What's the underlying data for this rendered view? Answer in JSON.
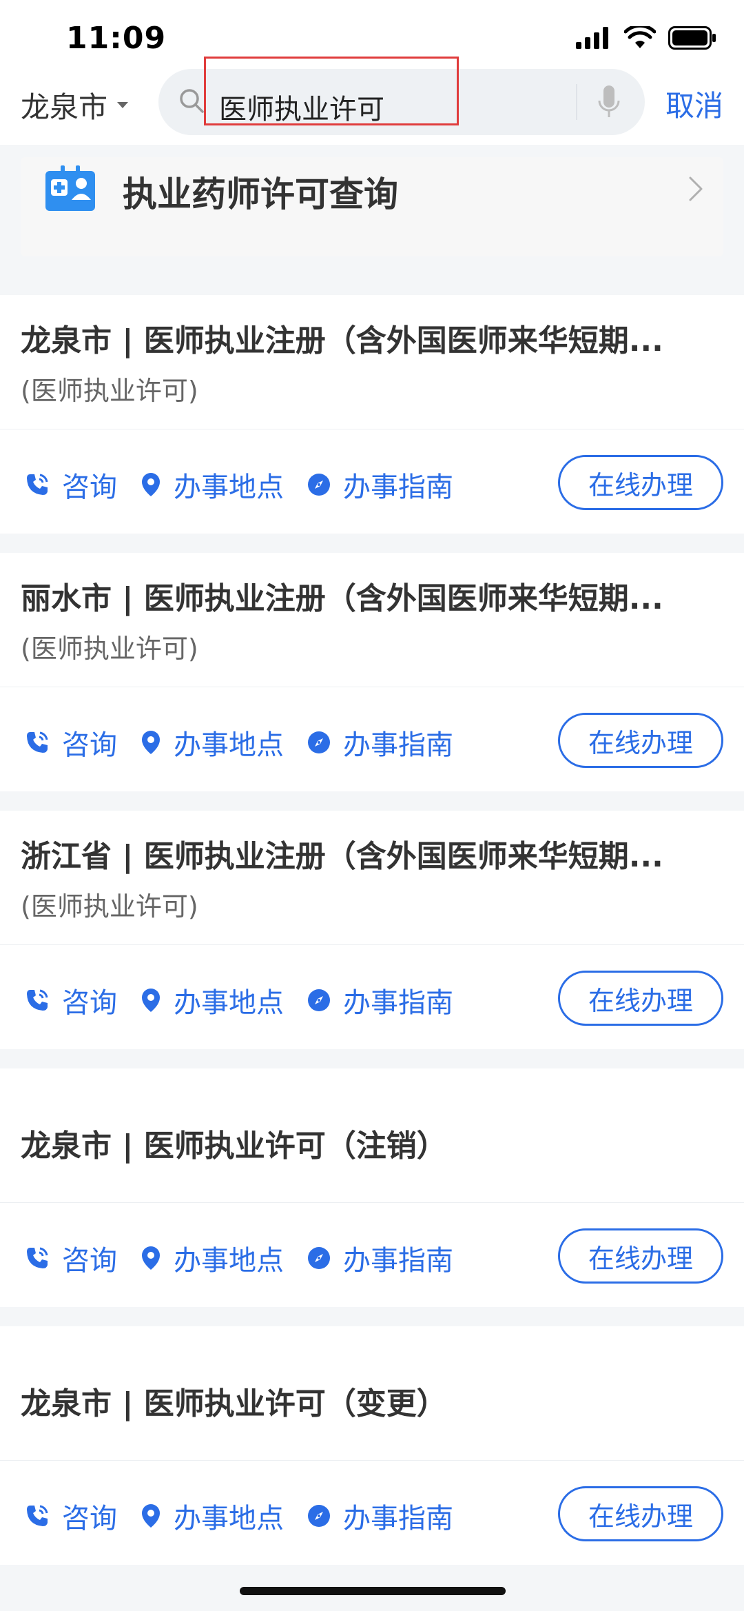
{
  "status_bar": {
    "time": "11:09"
  },
  "header": {
    "city": "龙泉市",
    "search_value": "医师执业许可",
    "cancel_label": "取消"
  },
  "feature_card": {
    "title": "执业药师许可查询"
  },
  "results": [
    {
      "title": "龙泉市 | 医师执业注册（含外国医师来华短期...",
      "subtitle": "(医师执业许可)"
    },
    {
      "title": "丽水市 | 医师执业注册（含外国医师来华短期...",
      "subtitle": "(医师执业许可)"
    },
    {
      "title": "浙江省 | 医师执业注册（含外国医师来华短期...",
      "subtitle": "(医师执业许可)"
    },
    {
      "title": "龙泉市 | 医师执业许可（注销）",
      "subtitle": ""
    },
    {
      "title": "龙泉市 | 医师执业许可（变更）",
      "subtitle": ""
    }
  ],
  "actions": {
    "consult": "咨询",
    "location": "办事地点",
    "guide": "办事指南",
    "online": "在线办理"
  },
  "colors": {
    "accent": "#2b6de6",
    "highlight": "#e03c3c"
  }
}
